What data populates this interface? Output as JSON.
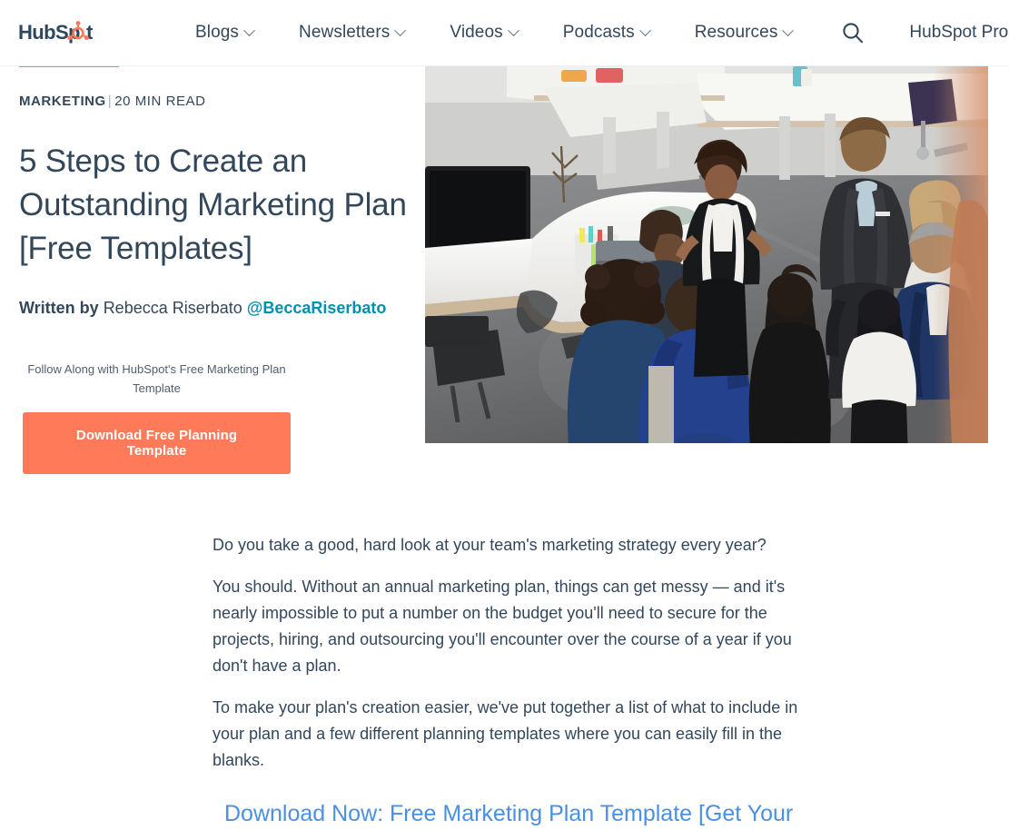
{
  "header": {
    "logo_text": "HubSpot",
    "nav_items": [
      {
        "label": "Blogs",
        "has_caret": true
      },
      {
        "label": "Newsletters",
        "has_caret": true
      },
      {
        "label": "Videos",
        "has_caret": true
      },
      {
        "label": "Podcasts",
        "has_caret": true
      },
      {
        "label": "Resources",
        "has_caret": true
      }
    ],
    "search_icon": "search-icon",
    "products": {
      "label": "HubSpot Products",
      "has_caret": true
    }
  },
  "article": {
    "topic": "MARKETING",
    "separator": "|",
    "read_time": "20 MIN READ",
    "title": "5 Steps to Create an Outstanding Marketing Plan [Free Templates]",
    "byline": {
      "written_by": "Written by",
      "author": "Rebecca Riserbato",
      "handle": "@BeccaRiserbato"
    },
    "cta": {
      "caption": "Follow Along with HubSpot's Free Marketing Plan Template",
      "button_label": "Download Free Planning Template"
    },
    "hero_image_alt": "office-team-meeting-photo",
    "paragraphs": [
      "Do you take a good, hard look at your team's marketing strategy every year?",
      "You should. Without an annual marketing plan, things can get messy — and it's nearly impossible to put a number on the budget you'll need to secure for the projects, hiring, and outsourcing you'll encounter over the course of a year if you don't have a plan.",
      "To make your plan's creation easier, we've put together a list of what to include in your plan and a few different planning templates where you can easily fill in the blanks."
    ],
    "inline_link": "Download Now: Free Marketing Plan Template [Get Your"
  },
  "colors": {
    "brand_orange": "#ff7a59",
    "navy": "#33475b",
    "teal_link": "#0091ae",
    "blue_link": "#4a90e2",
    "border": "#eaf0f6"
  }
}
